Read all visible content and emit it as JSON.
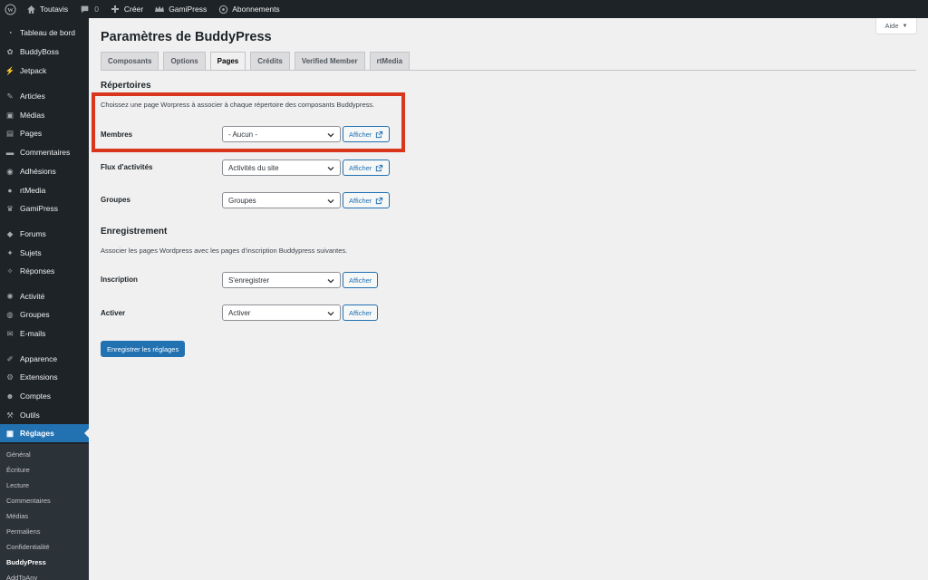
{
  "admin_bar": {
    "site_name": "Toutavis",
    "comments_count": "0",
    "create_label": "Créer",
    "gamipress_label": "GamiPress",
    "subscriptions_label": "Abonnements"
  },
  "sidebar": {
    "items": [
      {
        "label": "Tableau de bord",
        "icon": "dashboard-icon"
      },
      {
        "label": "BuddyBoss",
        "icon": "buddyboss-icon"
      },
      {
        "label": "Jetpack",
        "icon": "jetpack-icon"
      },
      {
        "label": "Articles",
        "icon": "pin-icon"
      },
      {
        "label": "Médias",
        "icon": "media-icon"
      },
      {
        "label": "Pages",
        "icon": "page-icon"
      },
      {
        "label": "Commentaires",
        "icon": "comment-icon"
      },
      {
        "label": "Adhésions",
        "icon": "membership-icon"
      },
      {
        "label": "rtMedia",
        "icon": "rtmedia-icon"
      },
      {
        "label": "GamiPress",
        "icon": "gamipress-icon"
      },
      {
        "label": "Forums",
        "icon": "forums-icon"
      },
      {
        "label": "Sujets",
        "icon": "topics-icon"
      },
      {
        "label": "Réponses",
        "icon": "replies-icon"
      },
      {
        "label": "Activité",
        "icon": "activity-icon"
      },
      {
        "label": "Groupes",
        "icon": "groups-icon"
      },
      {
        "label": "E-mails",
        "icon": "email-icon"
      },
      {
        "label": "Apparence",
        "icon": "appearance-icon"
      },
      {
        "label": "Extensions",
        "icon": "plugins-icon"
      },
      {
        "label": "Comptes",
        "icon": "users-icon"
      },
      {
        "label": "Outils",
        "icon": "tools-icon"
      },
      {
        "label": "Réglages",
        "icon": "settings-icon"
      }
    ],
    "submenu": [
      "Général",
      "Écriture",
      "Lecture",
      "Commentaires",
      "Médias",
      "Permaliens",
      "Confidentialité",
      "BuddyPress",
      "AddToAny"
    ]
  },
  "help_label": "Aide",
  "page_title": "Paramètres de BuddyPress",
  "tabs": [
    "Composants",
    "Options",
    "Pages",
    "Crédits",
    "Verified Member",
    "rtMedia"
  ],
  "directories": {
    "title": "Répertoires",
    "description": "Choissez une page Worpress à associer à chaque répertoire des composants Buddypress.",
    "rows": [
      {
        "label": "Membres",
        "value": "- Aucun -",
        "button": "Afficher"
      },
      {
        "label": "Flux d'activités",
        "value": "Activités du site",
        "button": "Afficher"
      },
      {
        "label": "Groupes",
        "value": "Groupes",
        "button": "Afficher"
      }
    ]
  },
  "registration": {
    "title": "Enregistrement",
    "description": "Associer les pages Wordpress avec les pages d'inscription Buddypress suivantes.",
    "rows": [
      {
        "label": "Inscription",
        "value": "S'enregistrer",
        "button": "Afficher"
      },
      {
        "label": "Activer",
        "value": "Activer",
        "button": "Afficher"
      }
    ]
  },
  "submit_label": "Enregistrer les réglages",
  "colors": {
    "admin_bg": "#1d2327",
    "accent": "#2271b1",
    "highlight": "#d9361e",
    "page_bg": "#f0f0f1"
  }
}
